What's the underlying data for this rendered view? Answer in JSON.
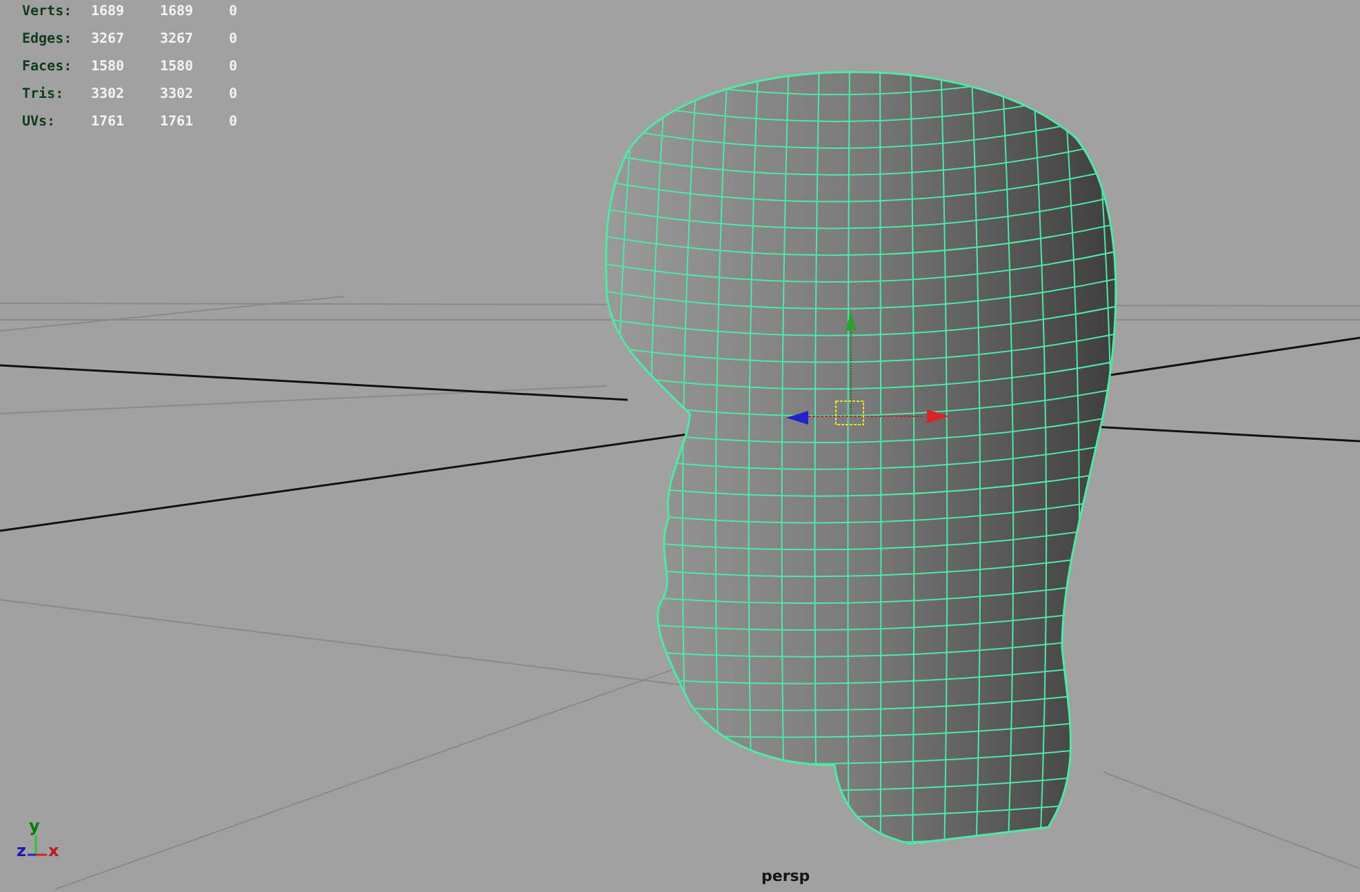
{
  "stats": [
    {
      "label": "Verts:",
      "values": [
        "1689",
        "1689",
        "0"
      ]
    },
    {
      "label": "Edges:",
      "values": [
        "3267",
        "3267",
        "0"
      ]
    },
    {
      "label": "Faces:",
      "values": [
        "1580",
        "1580",
        "0"
      ]
    },
    {
      "label": "Tris:",
      "values": [
        "3302",
        "3302",
        "0"
      ]
    },
    {
      "label": "UVs:",
      "values": [
        "1761",
        "1761",
        "0"
      ]
    }
  ],
  "axis_indicator": {
    "y": "y",
    "z": "z",
    "x": "x"
  },
  "camera_label": "persp"
}
